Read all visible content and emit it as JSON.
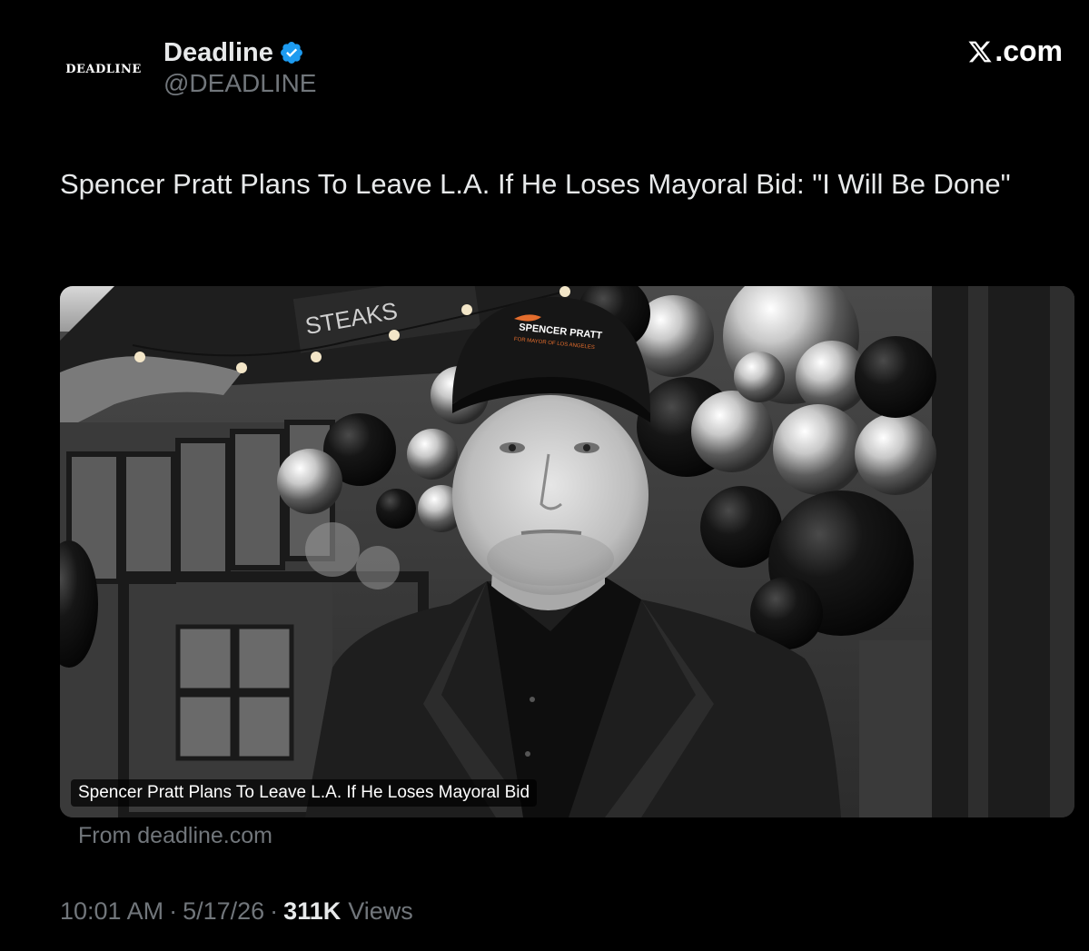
{
  "author": {
    "avatar_text": "DEADLINE",
    "display_name": "Deadline",
    "handle": "@DEADLINE",
    "verified": true,
    "verified_color": "#1d9bf0"
  },
  "platform": {
    "logo_text": ".com",
    "logo_icon": "x-logo-icon"
  },
  "tweet": {
    "text": "Spencer Pratt Plans To Leave L.A. If He Loses Mayoral Bid: \"I Will Be Done\""
  },
  "link_card": {
    "image_signage": "STEAKS",
    "hat_text_line1": "SPENCER PRATT",
    "hat_text_line2": "FOR MAYOR OF LOS ANGELES",
    "caption": "Spencer Pratt Plans To Leave L.A. If He Loses Mayoral Bid",
    "source": "From deadline.com"
  },
  "meta": {
    "time": "10:01 AM",
    "date": "5/17/26",
    "views_count": "311K",
    "views_label": "Views",
    "separator": "·"
  },
  "colors": {
    "background": "#000000",
    "primary_text": "#e7e9ea",
    "secondary_text": "#71767b"
  }
}
